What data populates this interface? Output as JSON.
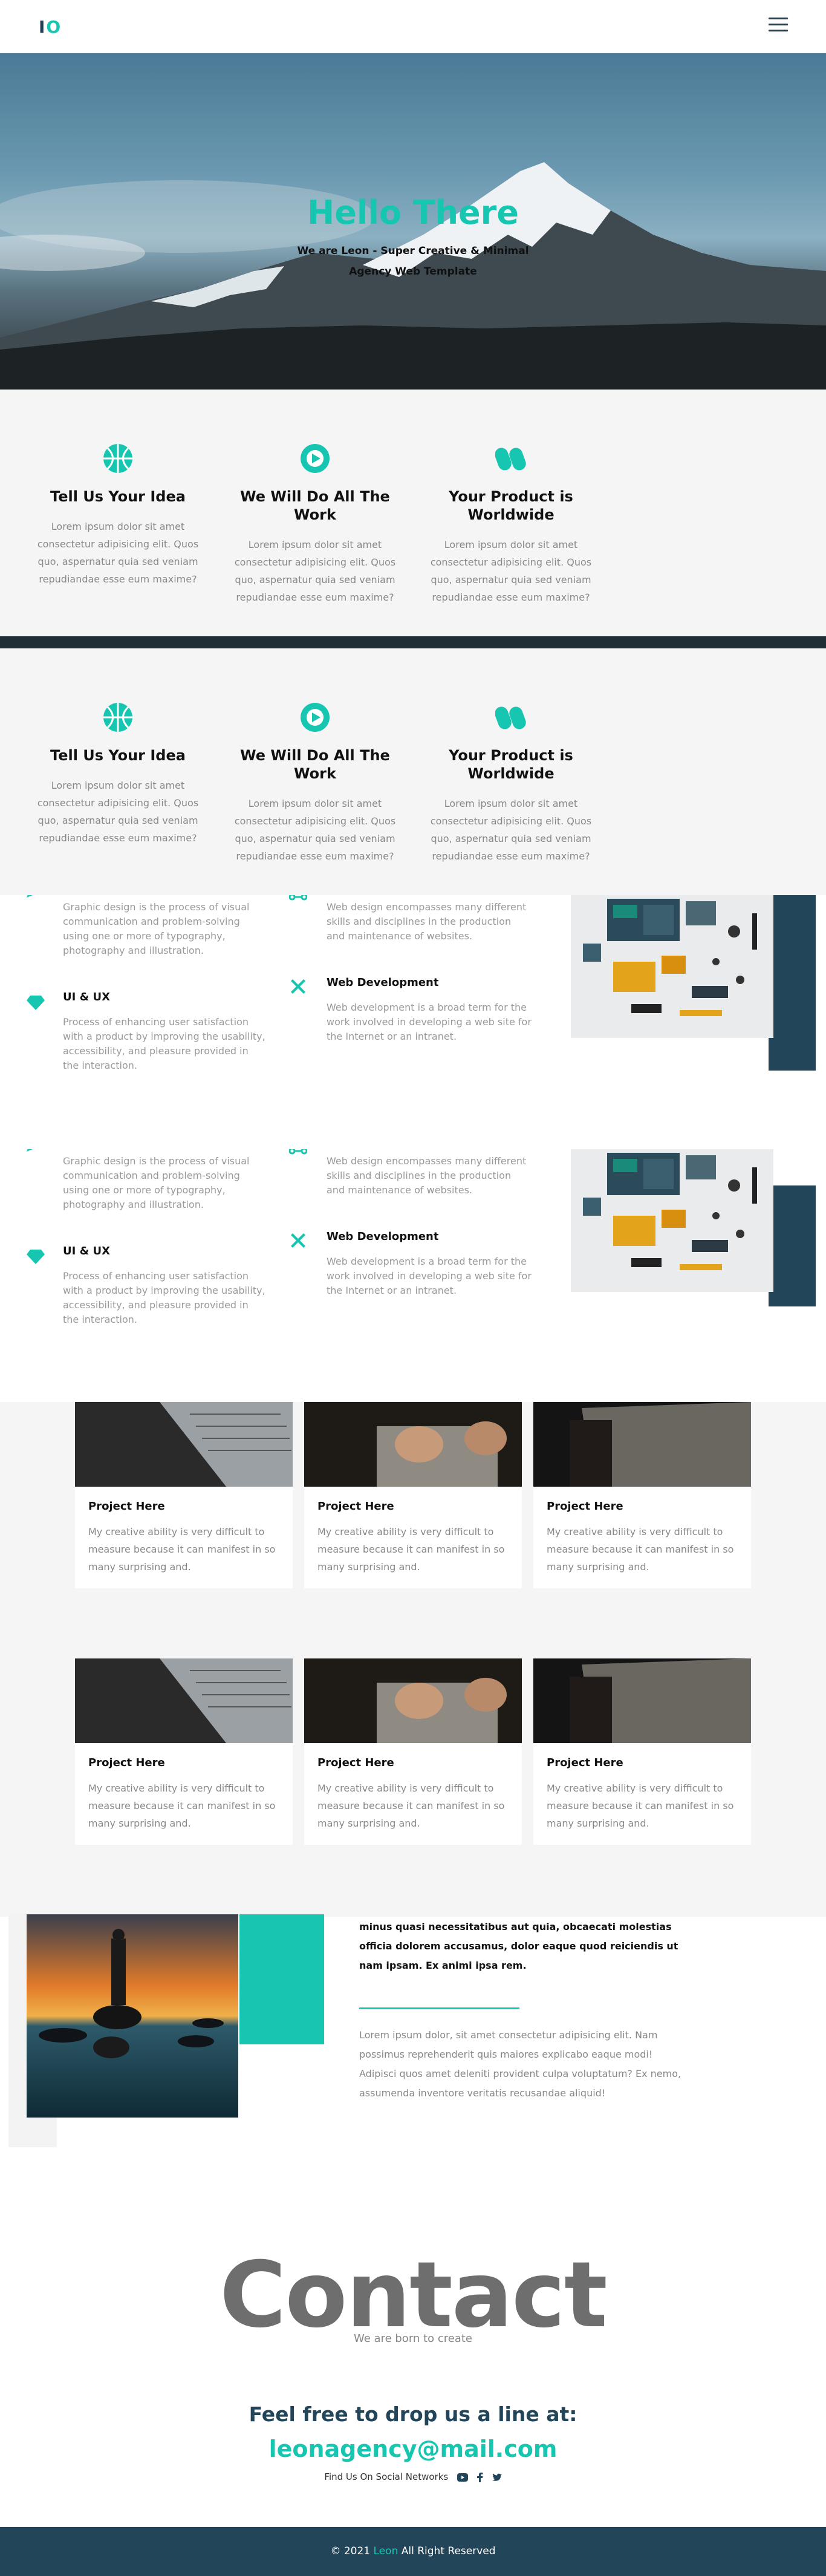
{
  "header": {
    "logo_i": "I",
    "logo_o": "O",
    "menu_icon": "hamburger-icon"
  },
  "hero": {
    "title": "Hello There",
    "subtitle": "We are Leon - Super Creative & Minimal Agency Web Template"
  },
  "features": [
    {
      "icon": "basketball-icon",
      "title": "Tell Us Your Idea",
      "text": "Lorem ipsum dolor sit amet consectetur adipisicing elit. Quos quo, aspernatur quia sed veniam repudiandae esse eum maxime?"
    },
    {
      "icon": "play-circle-icon",
      "title": "We Will Do All The Work",
      "text": "Lorem ipsum dolor sit amet consectetur adipisicing elit. Quos quo, aspernatur quia sed veniam repudiandae esse eum maxime?"
    },
    {
      "icon": "pills-icon",
      "title": "Your Product is Worldwide",
      "text": "Lorem ipsum dolor sit amet consectetur adipisicing elit. Quos quo, aspernatur quia sed veniam repudiandae esse eum maxime?"
    }
  ],
  "services": {
    "graphic_text": "Graphic design is the process of visual communication and problem-solving using one or more of typography, photography and illustration.",
    "webdesign_text": "Web design encompasses many different skills and disciplines in the production and maintenance of websites.",
    "uiux_title": "UI & UX",
    "uiux_text": "Process of enhancing user satisfaction with a product by improving the usability, accessibility, and pleasure provided in the interaction.",
    "webdev_title": "Web Development",
    "webdev_text": "Web development is a broad term for the work involved in developing a web site for the Internet or an intranet."
  },
  "projects": [
    {
      "title": "Project Here",
      "text": "My creative ability is very difficult to measure because it can manifest in so many surprising and."
    },
    {
      "title": "Project Here",
      "text": "My creative ability is very difficult to measure because it can manifest in so many surprising and."
    },
    {
      "title": "Project Here",
      "text": "My creative ability is very difficult to measure because it can manifest in so many surprising and."
    }
  ],
  "about": {
    "bold_text": "minus quasi necessitatibus aut quia, obcaecati molestias officia dolorem accusamus, dolor eaque quod reiciendis ut nam ipsam. Ex animi ipsa rem.",
    "text": "Lorem ipsum dolor, sit amet consectetur adipisicing elit. Nam possimus reprehenderit quis maiores explicabo eaque modi! Adipisci quos amet deleniti provident culpa voluptatum? Ex nemo, assumenda inventore veritatis recusandae aliquid!"
  },
  "contact": {
    "big_title": "Contact",
    "subtitle": "We are born to create",
    "line": "Feel free to drop us a line at:",
    "email": "leonagency@mail.com",
    "social_label": "Find Us On Social Networks",
    "social_icons": [
      "youtube-icon",
      "facebook-icon",
      "twitter-icon"
    ]
  },
  "footer": {
    "prefix": "© 2021",
    "brand": "Leon",
    "suffix": "All Right Reserved"
  },
  "colors": {
    "accent": "#17c6b1",
    "dark": "#22455a"
  }
}
